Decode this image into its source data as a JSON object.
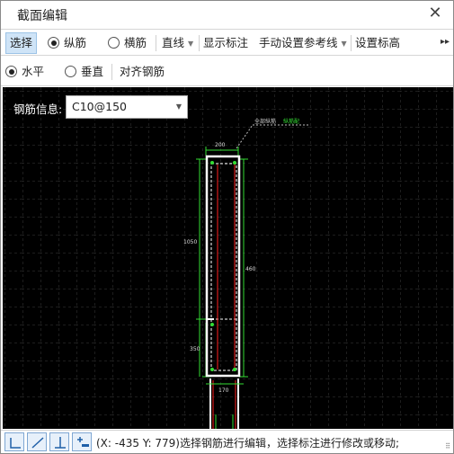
{
  "window": {
    "title": "截面编辑",
    "close_label": "✕"
  },
  "toolbar1": {
    "select": "选择",
    "radio_longitudinal": "纵筋",
    "radio_transverse": "横筋",
    "line_mode": "直线",
    "show_dims": "显示标注",
    "manual_ref": "手动设置参考线",
    "set_elev": "设置标高",
    "more": "▸▸"
  },
  "toolbar2": {
    "radio_horizontal": "水平",
    "radio_vertical": "垂直",
    "align_rebar": "对齐钢筋"
  },
  "canvas": {
    "info_label": "钢筋信息:",
    "rebar_value": "C10@150",
    "dims": {
      "top_width": "200",
      "left_height": "1050",
      "right_height": "460",
      "lower_left": "350",
      "bottom_width": "170"
    },
    "annotation_white": "全部纵筋",
    "annotation_green": "纵筋配"
  },
  "status": {
    "coords": "(X: -435 Y: 779)",
    "message": "选择钢筋进行编辑，选择标注进行修改或移动;"
  },
  "colors": {
    "canvas_bg": "#000000",
    "dim_green": "#33dd33",
    "rebar_red": "#ff2020",
    "grid": "#333333"
  }
}
